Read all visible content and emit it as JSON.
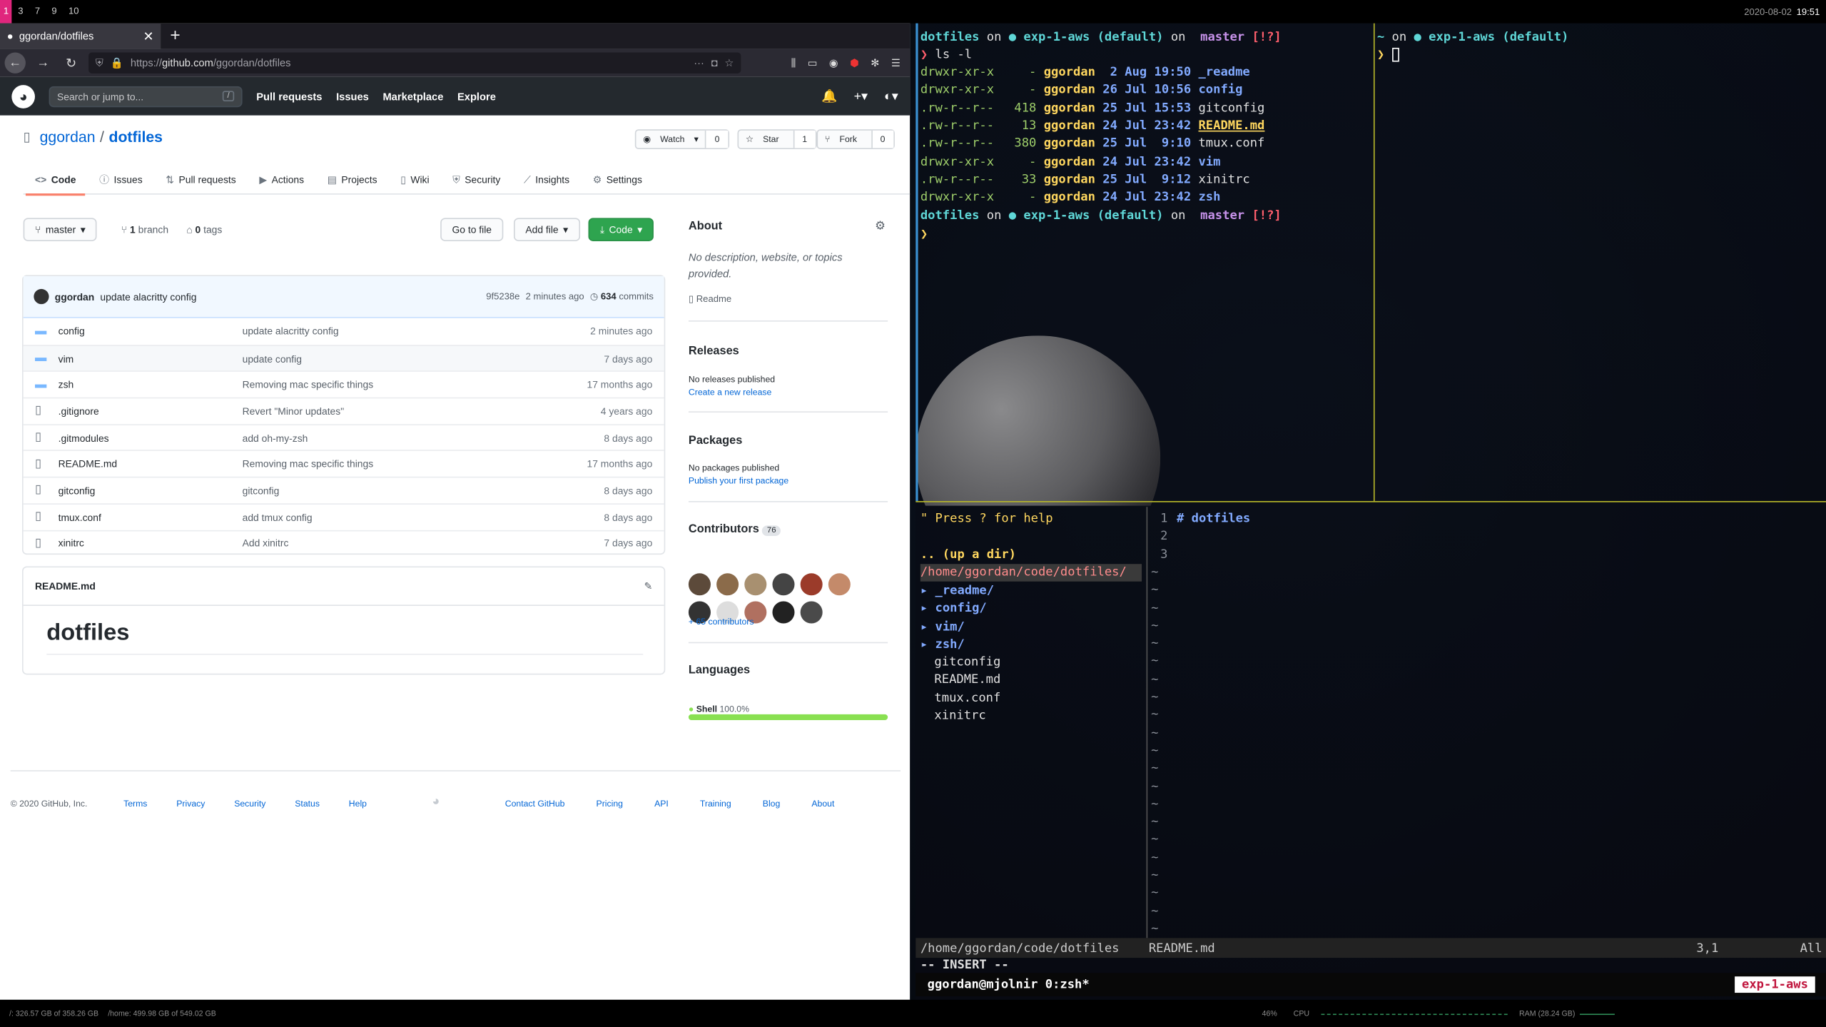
{
  "topbar": {
    "workspaces": [
      "1",
      "3",
      "7",
      "9",
      "10"
    ],
    "date": "2020-08-02",
    "time": "19:51"
  },
  "browser": {
    "tab_title": "ggordan/dotfiles",
    "url_prefix": "https://",
    "url_domain": "github.com",
    "url_path": "/ggordan/dotfiles"
  },
  "github": {
    "search_placeholder": "Search or jump to...",
    "nav": [
      "Pull requests",
      "Issues",
      "Marketplace",
      "Explore"
    ],
    "owner": "ggordan",
    "repo": "dotfiles",
    "watch": {
      "label": "Watch",
      "count": "0"
    },
    "star": {
      "label": "Star",
      "count": "1"
    },
    "fork": {
      "label": "Fork",
      "count": "0"
    },
    "tabs": [
      "Code",
      "Issues",
      "Pull requests",
      "Actions",
      "Projects",
      "Wiki",
      "Security",
      "Insights",
      "Settings"
    ],
    "branch": "master",
    "branches": "1",
    "branches_label": "branch",
    "tags": "0",
    "tags_label": "tags",
    "go_to_file": "Go to file",
    "add_file": "Add file",
    "code_btn": "Code",
    "commit": {
      "author": "ggordan",
      "message": "update alacritty config",
      "sha": "9f5238e",
      "time": "2 minutes ago",
      "count": "634",
      "count_label": "commits"
    },
    "files": [
      {
        "name": "config",
        "type": "dir",
        "msg": "update alacritty config",
        "time": "2 minutes ago"
      },
      {
        "name": "vim",
        "type": "dir",
        "msg": "update config",
        "time": "7 days ago"
      },
      {
        "name": "zsh",
        "type": "dir",
        "msg": "Removing mac specific things",
        "time": "17 months ago"
      },
      {
        "name": ".gitignore",
        "type": "file",
        "msg": "Revert \"Minor updates\"",
        "time": "4 years ago"
      },
      {
        "name": ".gitmodules",
        "type": "file",
        "msg": "add oh-my-zsh",
        "time": "8 days ago"
      },
      {
        "name": "README.md",
        "type": "file",
        "msg": "Removing mac specific things",
        "time": "17 months ago"
      },
      {
        "name": "gitconfig",
        "type": "file",
        "msg": "gitconfig",
        "time": "8 days ago"
      },
      {
        "name": "tmux.conf",
        "type": "file",
        "msg": "add tmux config",
        "time": "8 days ago"
      },
      {
        "name": "xinitrc",
        "type": "file",
        "msg": "Add xinitrc",
        "time": "7 days ago"
      }
    ],
    "readme_file": "README.md",
    "readme_title": "dotfiles",
    "about": {
      "title": "About",
      "desc": "No description, website, or topics provided.",
      "readme": "Readme"
    },
    "releases": {
      "title": "Releases",
      "text": "No releases published",
      "link": "Create a new release"
    },
    "packages": {
      "title": "Packages",
      "text": "No packages published",
      "link": "Publish your first package"
    },
    "contributors": {
      "title": "Contributors",
      "count": "76",
      "more": "+ 65 contributors",
      "avatar_colors": [
        "#5c4a3a",
        "#8b6b4a",
        "#a89070",
        "#444",
        "#9b3b2a",
        "#c48a6a",
        "#333",
        "#ddd",
        "#b07060",
        "#222",
        "#4a4a4a"
      ]
    },
    "languages": {
      "title": "Languages",
      "name": "Shell",
      "pct": "100.0%",
      "color": "#89e051",
      "value": 100
    },
    "footer": {
      "copy": "© 2020 GitHub, Inc.",
      "left": [
        "Terms",
        "Privacy",
        "Security",
        "Status",
        "Help"
      ],
      "right": [
        "Contact GitHub",
        "Pricing",
        "API",
        "Training",
        "Blog",
        "About"
      ]
    }
  },
  "terminal": {
    "prompt": {
      "dir": "dotfiles",
      "on": "on",
      "ctx": "exp-1-aws (default)",
      "branch": "master",
      "status": "[!?]"
    },
    "cmd": "ls -l",
    "ls": [
      {
        "perm": "drwxr-xr-x",
        "size": "-",
        "user": "ggordan",
        "date": " 2 Aug 19:50",
        "name": "_readme",
        "kind": "dir"
      },
      {
        "perm": "drwxr-xr-x",
        "size": "-",
        "user": "ggordan",
        "date": "26 Jul 10:56",
        "name": "config",
        "kind": "dir"
      },
      {
        "perm": ".rw-r--r--",
        "size": "418",
        "user": "ggordan",
        "date": "25 Jul 15:53",
        "name": "gitconfig",
        "kind": "file"
      },
      {
        "perm": ".rw-r--r--",
        "size": "13",
        "user": "ggordan",
        "date": "24 Jul 23:42",
        "name": "README.md",
        "kind": "md"
      },
      {
        "perm": ".rw-r--r--",
        "size": "380",
        "user": "ggordan",
        "date": "25 Jul  9:10",
        "name": "tmux.conf",
        "kind": "file"
      },
      {
        "perm": "drwxr-xr-x",
        "size": "-",
        "user": "ggordan",
        "date": "24 Jul 23:42",
        "name": "vim",
        "kind": "dir"
      },
      {
        "perm": ".rw-r--r--",
        "size": "33",
        "user": "ggordan",
        "date": "25 Jul  9:12",
        "name": "xinitrc",
        "kind": "file"
      },
      {
        "perm": "drwxr-xr-x",
        "size": "-",
        "user": "ggordan",
        "date": "24 Jul 23:42",
        "name": "zsh",
        "kind": "dir"
      }
    ],
    "right_prompt": {
      "dir": "~",
      "on": "on",
      "ctx": "exp-1-aws (default)"
    },
    "nerdtree": {
      "help": "\" Press ? for help",
      "updir": ".. (up a dir)",
      "root": "/home/ggordan/code/dotfiles/",
      "dirs": [
        "_readme/",
        "config/",
        "vim/",
        "zsh/"
      ],
      "files": [
        "gitconfig",
        "README.md",
        "tmux.conf",
        "xinitrc"
      ]
    },
    "editor": {
      "lines": [
        "1",
        "2",
        "3"
      ],
      "heading": "# dotfiles"
    },
    "status": {
      "left": "/home/ggordan/code/dotfiles",
      "file": "README.md",
      "pos": "3,1",
      "all": "All"
    },
    "mode": "-- INSERT --",
    "tmux": {
      "left": "ggordan@mjolnir 0:zsh*",
      "session": "exp-1-aws"
    }
  },
  "statusbar": {
    "root": "/: 326.57 GB of 358.26 GB",
    "home": "/home: 499.98 GB of 549.02 GB",
    "cpu_pct": "46%",
    "cpu": "CPU",
    "ram": "RAM (28.24 GB)"
  }
}
